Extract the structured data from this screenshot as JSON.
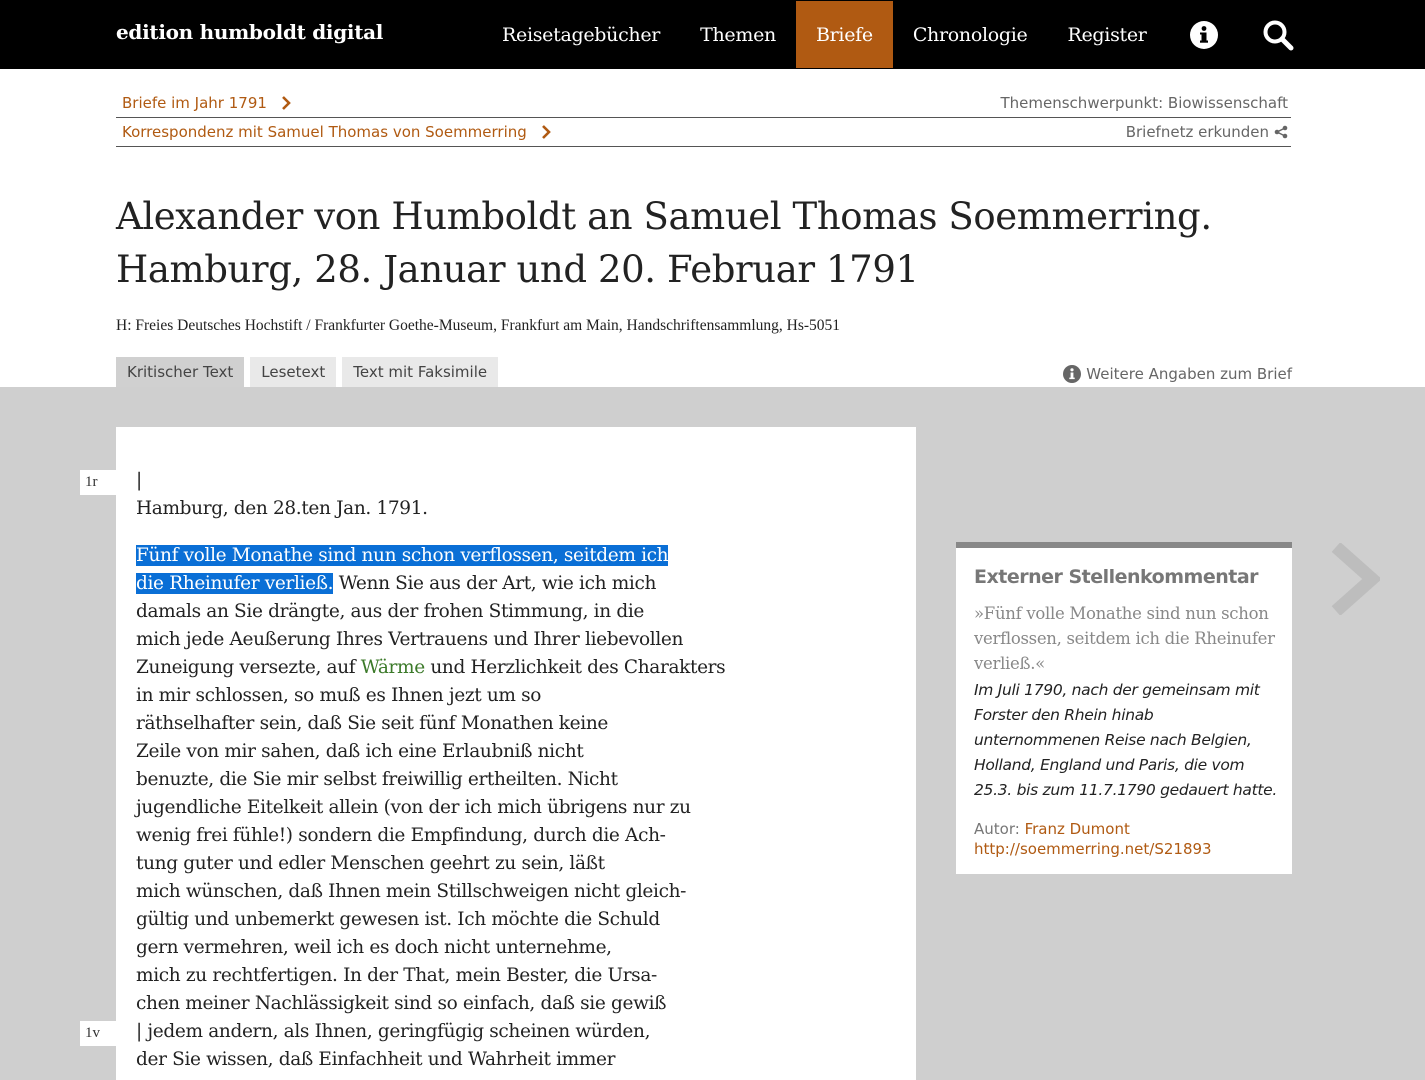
{
  "brand": "edition humboldt digital",
  "nav": {
    "items": [
      {
        "label": "Reisetagebücher"
      },
      {
        "label": "Themen"
      },
      {
        "label": "Briefe"
      },
      {
        "label": "Chronologie"
      },
      {
        "label": "Register"
      }
    ],
    "active": "Briefe",
    "icons": [
      "info-icon",
      "search-icon"
    ]
  },
  "breadcrumbs": {
    "row1_left": "Briefe im Jahr 1791",
    "row1_right": "Themenschwerpunkt: Biowissenschaft",
    "row2_left": "Korrespondenz mit Samuel Thomas von Soemmerring",
    "row2_right": "Briefnetz erkunden"
  },
  "title": {
    "line1": "Alexander von Humboldt an Samuel Thomas Soemmerring.",
    "line2": "Hamburg, 28. Januar und 20. Februar 1791"
  },
  "source": "H: Freies Deutsches Hochstift / Frankfurter Goethe-Museum, Frankfurt am Main, Handschriftensammlung, Hs-5051",
  "tabs": [
    {
      "label": "Kritischer Text",
      "active": true
    },
    {
      "label": "Lesetext",
      "active": false
    },
    {
      "label": "Text mit Faksimile",
      "active": false
    }
  ],
  "more_info": "Weitere Angaben zum Brief",
  "folios": [
    "1r",
    "1v"
  ],
  "letter": {
    "marker": "|",
    "dateline": "Hamburg, den 28.ten Jan. 1791.",
    "hl1": "Fünf volle Monathe sind nun schon verflossen, seitdem ich",
    "hl2": "die Rheinufer verließ.",
    "l2_rest": " Wenn Sie aus der Art, wie ich mich",
    "l3": "damals an Sie drängte, aus der frohen Stimmung, in die",
    "l4": "mich jede Aeußerung Ihres Vertrauens und Ihrer liebevollen",
    "l5_a": "Zuneigung versezte, auf ",
    "l5_green": "Wärme",
    "l5_b": " und Herzlichkeit des Charakters",
    "l6": "in mir schlossen, so muß es Ihnen jezt um so",
    "l7": "räthselhafter sein, daß Sie seit fünf Monathen keine",
    "l8": "Zeile von mir sahen, daß ich eine Erlaubniß nicht",
    "l9": "benuzte, die Sie mir selbst freiwillig ertheilten. Nicht",
    "l10": "jugendliche Eitelkeit allein (von der ich mich übrigens nur zu",
    "l11": "wenig frei fühle!) sondern die Empfindung, durch die Ach-",
    "l12": "tung guter und edler Menschen geehrt zu sein, läßt",
    "l13": "mich wünschen, daß Ihnen mein Stillschweigen nicht gleich-",
    "l14": "gültig und unbemerkt gewesen ist. Ich möchte die Schuld",
    "l15": "gern vermehren, weil ich es doch nicht unternehme,",
    "l16": "mich zu rechtfertigen. In der That, mein Bester, die Ursa-",
    "l17": "chen meiner Nachlässigkeit sind so einfach, daß sie gewiß",
    "l18": "| jedem andern, als Ihnen, geringfügig scheinen würden,",
    "l19": "der Sie wissen, daß Einfachheit und Wahrheit immer"
  },
  "commentary": {
    "heading": "Externer Stellenkommentar",
    "quote": "»Fünf volle Monathe sind nun schon verflossen, seitdem ich die Rheinufer verließ.«",
    "body": "Im Juli 1790, nach der gemeinsam mit Forster den Rhein hinab unternommenen Reise nach Belgien, Holland, England und Paris, die vom 25.3. bis zum 11.7.1790 gedauert hatte.",
    "author_label": "Autor: ",
    "author_name": "Franz Dumont",
    "link": "http://soemmerring.net/S21893"
  },
  "colors": {
    "accent": "#b05a12",
    "nav_bg": "#000000",
    "highlight": "#0a6fd6",
    "panel_bg": "#cfcfcf"
  }
}
